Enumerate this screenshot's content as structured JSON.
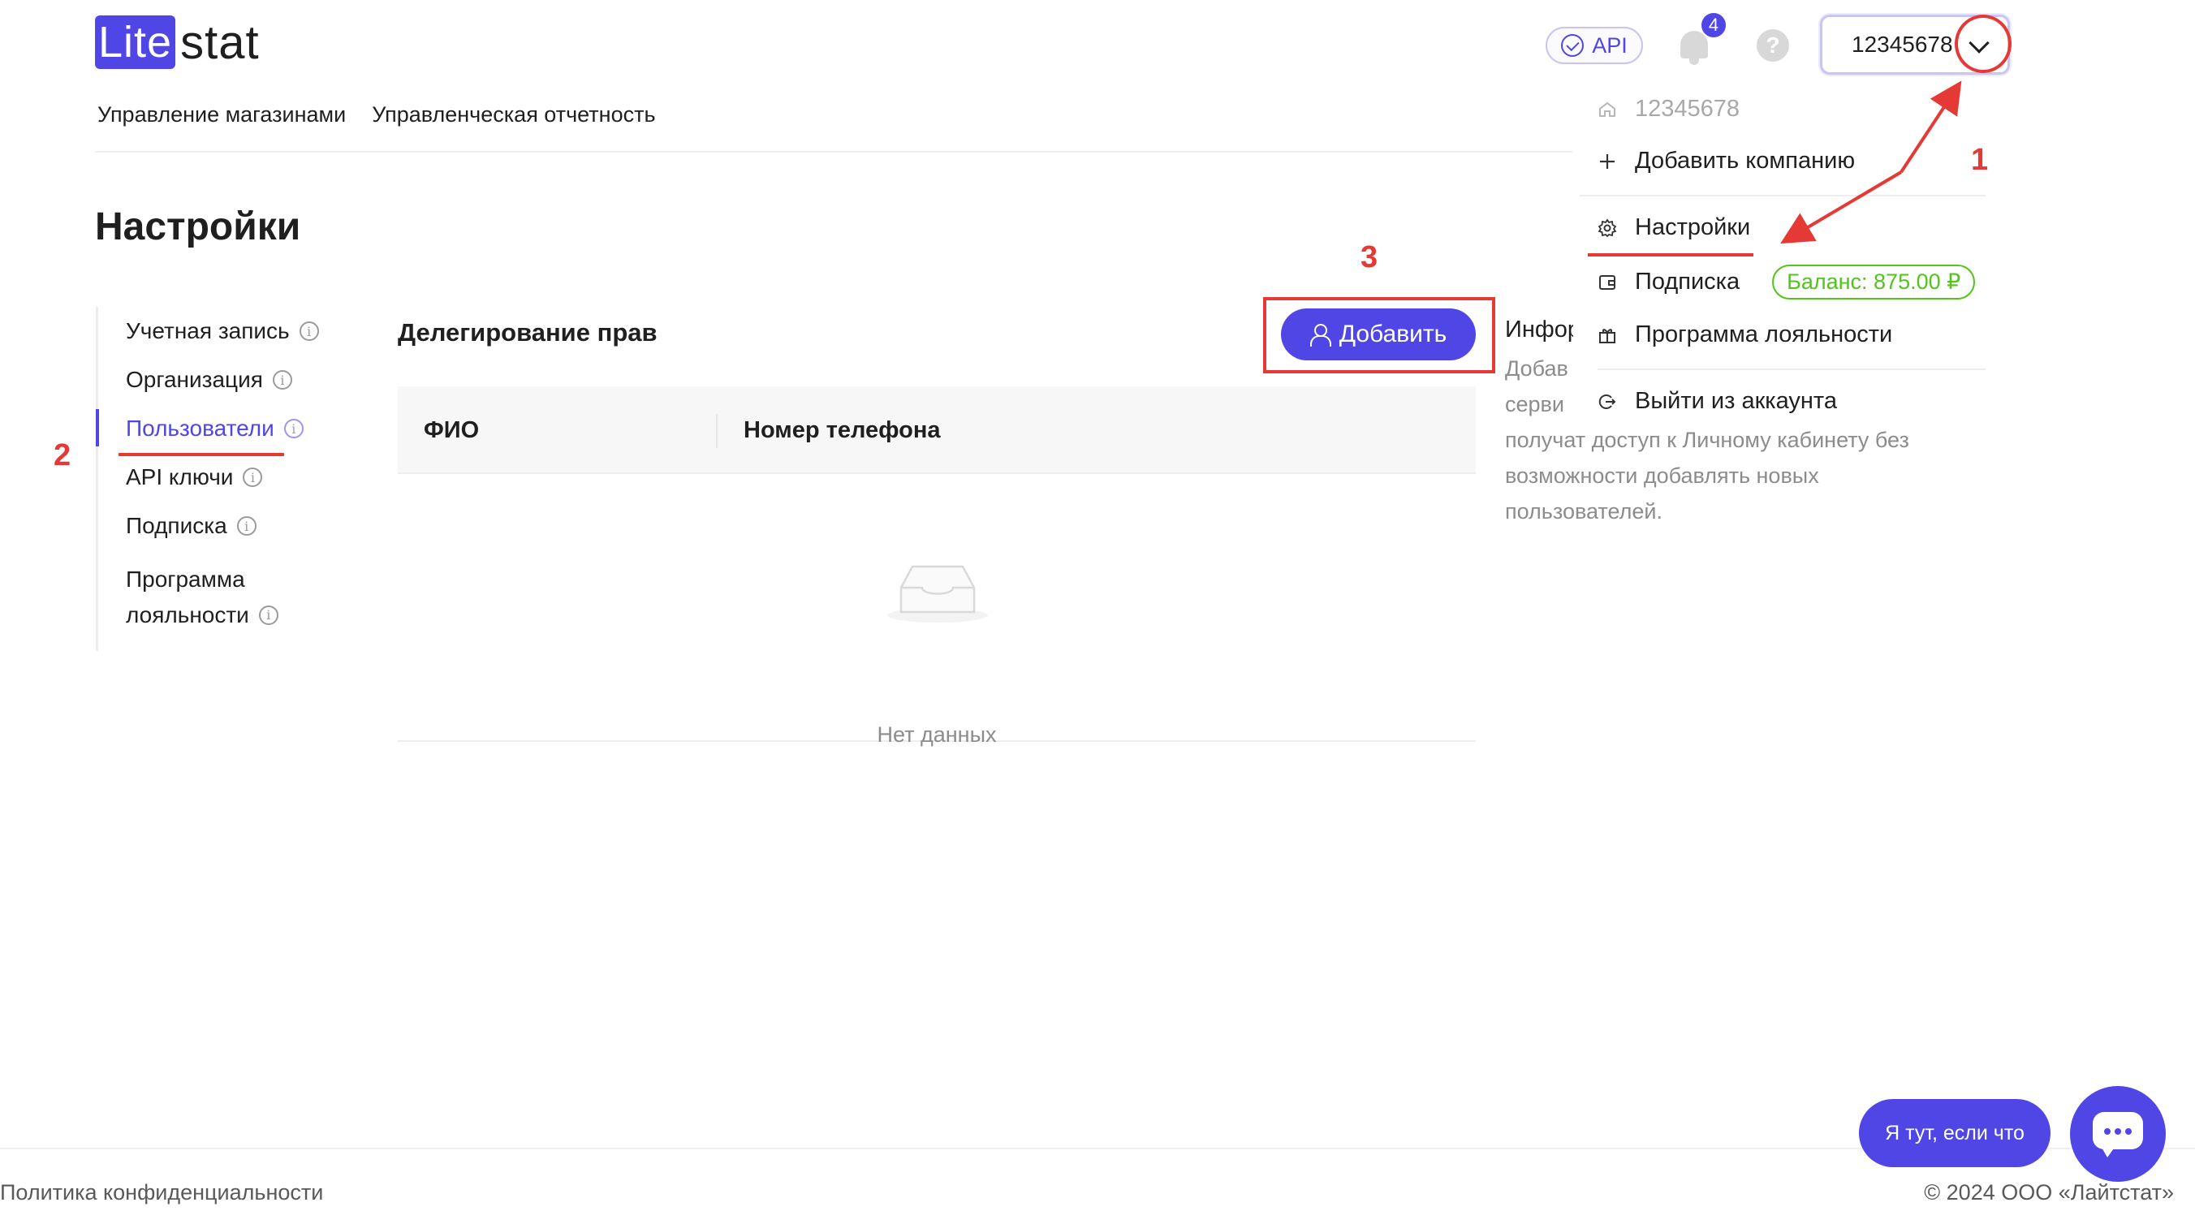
{
  "header": {
    "logo_highlight": "Lite",
    "logo_rest": "stat",
    "api_label": "API",
    "notification_count": "4",
    "help_glyph": "?",
    "company_id": "12345678"
  },
  "topnav": {
    "items": [
      "Управление магазинами",
      "Управленческая отчетность"
    ]
  },
  "dropdown": {
    "company_id": "12345678",
    "add_company": "Добавить компанию",
    "settings": "Настройки",
    "subscription": "Подписка",
    "balance": "Баланс: 875.00 ₽",
    "loyalty": "Программа лояльности",
    "logout": "Выйти из аккаунта"
  },
  "page": {
    "title": "Настройки"
  },
  "sidenav": {
    "items": [
      {
        "label": "Учетная запись"
      },
      {
        "label": "Организация"
      },
      {
        "label": "Пользователи"
      },
      {
        "label": "API ключи"
      },
      {
        "label": "Подписка"
      },
      {
        "label": "Программа",
        "label2": "лояльности"
      }
    ]
  },
  "section": {
    "title": "Делегирование прав",
    "add_button": "Добавить"
  },
  "table": {
    "columns": [
      "ФИО",
      "Номер телефона"
    ],
    "empty_text": "Нет данных"
  },
  "info_panel": {
    "heading": "Инфор",
    "lines": [
      "Добав",
      "серви",
      "получат доступ к Личному кабинету без",
      "возможности добавлять новых",
      "пользователей."
    ]
  },
  "annotations": [
    "1",
    "2",
    "3"
  ],
  "chat": {
    "pill_text": "Я тут, если что"
  },
  "footer": {
    "privacy": "Политика конфиденциальности",
    "copyright": "© 2024 ООО «Лайтстат»"
  },
  "colors": {
    "accent": "#4f46e5",
    "annotation": "#e53935",
    "balance": "#52c41a"
  }
}
